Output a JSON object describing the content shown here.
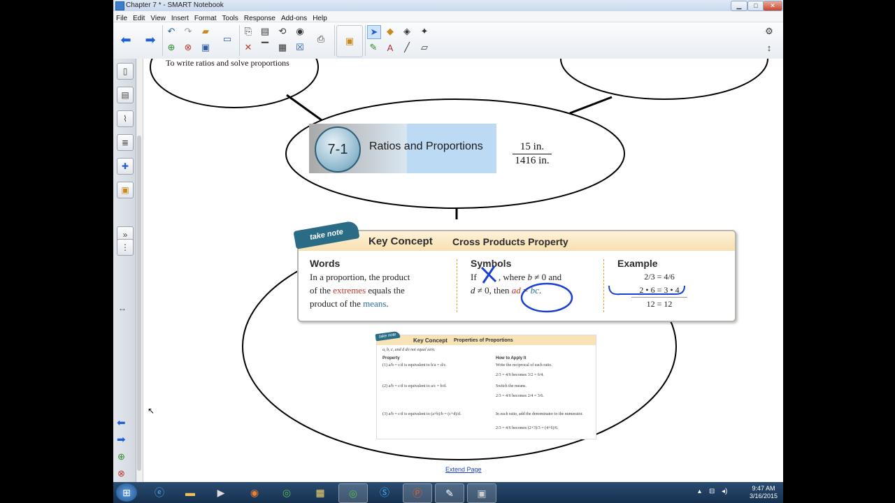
{
  "window": {
    "title": "Chapter 7 * - SMART Notebook",
    "min": "▁",
    "max": "□",
    "close": "✕"
  },
  "menu": [
    "File",
    "Edit",
    "View",
    "Insert",
    "Format",
    "Tools",
    "Response",
    "Add-ons",
    "Help"
  ],
  "canvas": {
    "objective": "To write ratios and solve proportions",
    "banner": {
      "number": "7-1",
      "title": "Ratios and Proportions"
    },
    "fraction": {
      "numerator": "15 in.",
      "denominator": "1416 in."
    },
    "key_concept": {
      "tag": "take note",
      "title": "Key Concept",
      "subtitle": "Cross Products Property",
      "words_head": "Words",
      "words_1": "In a proportion, the product",
      "words_2a": "of the ",
      "words_2b": "extremes",
      "words_2c": " equals the",
      "words_3a": "product of the ",
      "words_3b": "means",
      "words_3c": ".",
      "symbols_head": "Symbols",
      "symbols_1a": "If ",
      "symbols_1b": ", where ",
      "symbols_1c": "b",
      "symbols_1d": " ≠ 0 and",
      "symbols_2a": "d",
      "symbols_2b": " ≠ 0, then ",
      "symbols_2c": "ad",
      "symbols_2d": " = ",
      "symbols_2e": "bc",
      "symbols_2f": ".",
      "example_head": "Example",
      "example_1": "2/3 = 4/6",
      "example_2": "2 • 6 = 3 • 4",
      "example_3": "12 = 12"
    },
    "small_card": {
      "tag": "take note",
      "title": "Key Concept",
      "subtitle": "Properties of Proportions",
      "note": "a, b, c, and d do not equal zero.",
      "property_head": "Property",
      "p1": "(1) a/b = c/d is equivalent to b/a = d/c.",
      "p2": "(2) a/b = c/d is equivalent to a/c = b/d.",
      "p3": "(3) a/b = c/d is equivalent to (a+b)/b = (c+d)/d.",
      "how_head": "How to Apply It",
      "h1": "Write the reciprocal of each ratio.",
      "h1b": "2/3 = 4/6 becomes 3/2 = 6/4.",
      "h2": "Switch the means.",
      "h2b": "2/3 = 4/6 becomes 2/4 = 3/6.",
      "h3": "In each ratio, add the denominator to the numerator.",
      "h3b": "2/3 = 4/6 becomes (2+3)/3 = (4+6)/6."
    },
    "extend_link": "Extend Page"
  },
  "taskbar": {
    "time": "9:47 AM",
    "date": "3/16/2015"
  },
  "colors": {
    "accent_blue": "#1f5fd6",
    "ink_blue": "#1a3fd1",
    "teal_tag": "#2a6b86"
  }
}
